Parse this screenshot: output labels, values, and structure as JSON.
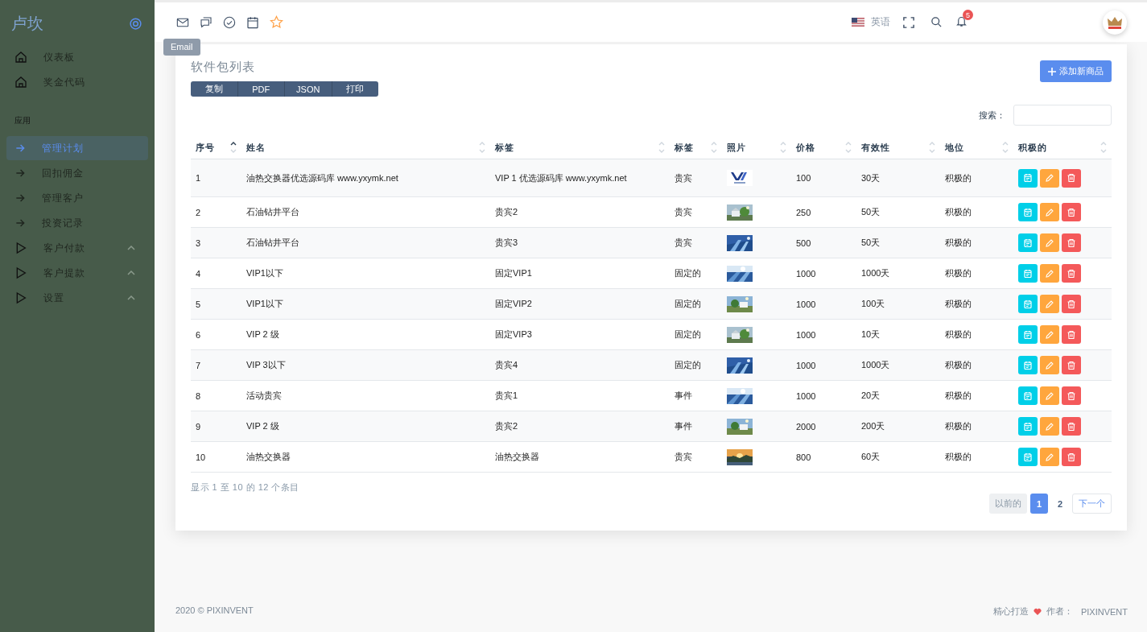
{
  "sidebar": {
    "brand": "卢坎",
    "items": [
      {
        "label": "仪表板",
        "kind": "home",
        "selected": false
      },
      {
        "label": "奖金代码",
        "kind": "home",
        "selected": false
      }
    ],
    "section_label": "应用",
    "app_items": [
      {
        "label": "管理计划",
        "kind": "arrow",
        "selected": true
      },
      {
        "label": "回扣佣金",
        "kind": "arrow",
        "selected": false
      },
      {
        "label": "管理客户",
        "kind": "arrow",
        "selected": false
      },
      {
        "label": "投资记录",
        "kind": "arrow",
        "selected": false
      },
      {
        "label": "客户付款",
        "kind": "group",
        "selected": false
      },
      {
        "label": "客户提款",
        "kind": "group",
        "selected": false
      },
      {
        "label": "设置",
        "kind": "group",
        "selected": false
      }
    ]
  },
  "navbar": {
    "shortcuts": [
      {
        "kind": "mail"
      },
      {
        "kind": "chat"
      },
      {
        "kind": "check"
      },
      {
        "kind": "calendar"
      },
      {
        "kind": "star"
      }
    ],
    "tooltip": "Email",
    "language": "英语",
    "notification_count": "5"
  },
  "card": {
    "title": "软件包列表",
    "export_buttons": [
      "复制",
      "PDF",
      "JSON",
      "打印"
    ],
    "add_button": "添加新商品",
    "search_label": "搜索：",
    "columns": [
      {
        "label": "序号",
        "sorted": true
      },
      {
        "label": "姓名",
        "sorted": false
      },
      {
        "label": "标签",
        "sorted": false
      },
      {
        "label": "标签",
        "sorted": false
      },
      {
        "label": "照片",
        "sorted": false
      },
      {
        "label": "价格",
        "sorted": false
      },
      {
        "label": "有效性",
        "sorted": false
      },
      {
        "label": "地位",
        "sorted": false
      },
      {
        "label": "积极的",
        "sorted": false
      }
    ],
    "rows": [
      {
        "no": "1",
        "name": "油热交换器优选源码库 www.yxymk.net",
        "tag": "VIP 1 优选源码库 www.yxymk.net",
        "label": "贵宾",
        "price": "100",
        "validity": "30天",
        "status": "积极的"
      },
      {
        "no": "2",
        "name": "石油钻井平台",
        "tag": "贵宾2",
        "label": "贵宾",
        "price": "250",
        "validity": "50天",
        "status": "积极的"
      },
      {
        "no": "3",
        "name": "石油钻井平台",
        "tag": "贵宾3",
        "label": "贵宾",
        "price": "500",
        "validity": "50天",
        "status": "积极的"
      },
      {
        "no": "4",
        "name": "VIP1以下",
        "tag": "固定VIP1",
        "label": "固定的",
        "price": "1000",
        "validity": "1000天",
        "status": "积极的"
      },
      {
        "no": "5",
        "name": "VIP1以下",
        "tag": "固定VIP2",
        "label": "固定的",
        "price": "1000",
        "validity": "100天",
        "status": "积极的"
      },
      {
        "no": "6",
        "name": "VIP 2 级",
        "tag": "固定VIP3",
        "label": "固定的",
        "price": "1000",
        "validity": "10天",
        "status": "积极的"
      },
      {
        "no": "7",
        "name": "VIP 3以下",
        "tag": "贵宾4",
        "label": "固定的",
        "price": "1000",
        "validity": "1000天",
        "status": "积极的"
      },
      {
        "no": "8",
        "name": "活动贵宾",
        "tag": "贵宾1",
        "label": "事件",
        "price": "1000",
        "validity": "20天",
        "status": "积极的"
      },
      {
        "no": "9",
        "name": "VIP 2 级",
        "tag": "贵宾2",
        "label": "事件",
        "price": "2000",
        "validity": "200天",
        "status": "积极的"
      },
      {
        "no": "10",
        "name": "油热交换器",
        "tag": "油热交换器",
        "label": "贵宾",
        "price": "800",
        "validity": "60天",
        "status": "积极的"
      }
    ],
    "info": "显示 1 至 10 的 12 个条目",
    "pagination": [
      {
        "label": "以前的",
        "kind": "prev",
        "disabled": true,
        "selected": false
      },
      {
        "label": "1",
        "kind": "page",
        "disabled": false,
        "selected": true
      },
      {
        "label": "2",
        "kind": "page",
        "disabled": false,
        "selected": false
      },
      {
        "label": "下一个",
        "kind": "next",
        "disabled": false,
        "selected": false
      }
    ]
  },
  "footer": {
    "copyright": "2020 © PIXINVENT",
    "made_with": "精心打造",
    "author_label": "作者：",
    "author": "PIXINVENT"
  }
}
